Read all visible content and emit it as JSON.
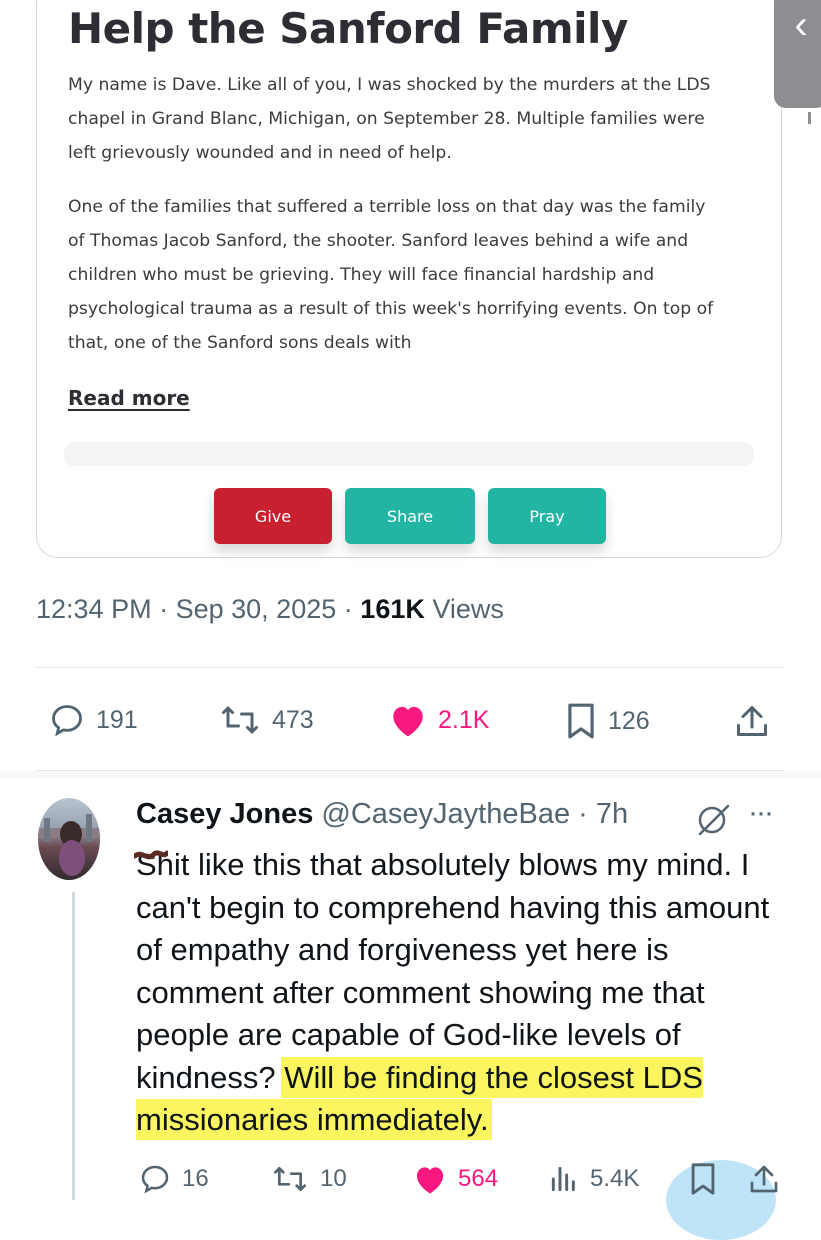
{
  "card": {
    "title": "Help the Sanford Family",
    "paragraph_1": "My name is Dave. Like all of you, I was shocked by the murders at the LDS chapel in Grand Blanc, Michigan, on September 28. Multiple families were left grievously wounded and in need of help.",
    "paragraph_2": "One of the families that suffered a terrible loss on that day was the family of Thomas Jacob Sanford, the shooter. Sanford leaves behind a wife and children who must be grieving. They will face financial hardship and psychological trauma as a result of this week's horrifying events. On top of that, one of the Sanford sons deals with",
    "read_more": "Read more",
    "buttons": {
      "give": "Give",
      "share": "Share",
      "pray": "Pray"
    },
    "colors": {
      "give": "#c8202f",
      "share": "#22b5a4",
      "pray": "#22b5a4"
    }
  },
  "scroll_tab_glyph": "‹",
  "post": {
    "time": "12:34 PM",
    "date": "Sep 30, 2025",
    "views_count": "161K",
    "views_label": "Views",
    "separator": "·"
  },
  "post_actions": {
    "replies": "191",
    "reposts": "473",
    "likes": "2.1K",
    "bookmarks": "126"
  },
  "reply": {
    "author_name": "Casey Jones",
    "handle": "@CaseyJaytheBae",
    "age": "7h",
    "separator": "·",
    "more": "···",
    "text_plain": "Shit like this that absolutely blows my mind. I can't begin to comprehend having this amount of empathy and forgiveness yet here is comment after comment showing me that people are capable of God-like levels of kindness? ",
    "text_highlighted": "Will be finding the closest LDS missionaries immediately.",
    "stats": {
      "replies": "16",
      "reposts": "10",
      "likes": "564",
      "views": "5.4K"
    }
  },
  "colors": {
    "like": "#f91880",
    "text": "#0f1419",
    "muted": "#536471",
    "highlight": "#fbf55f"
  }
}
